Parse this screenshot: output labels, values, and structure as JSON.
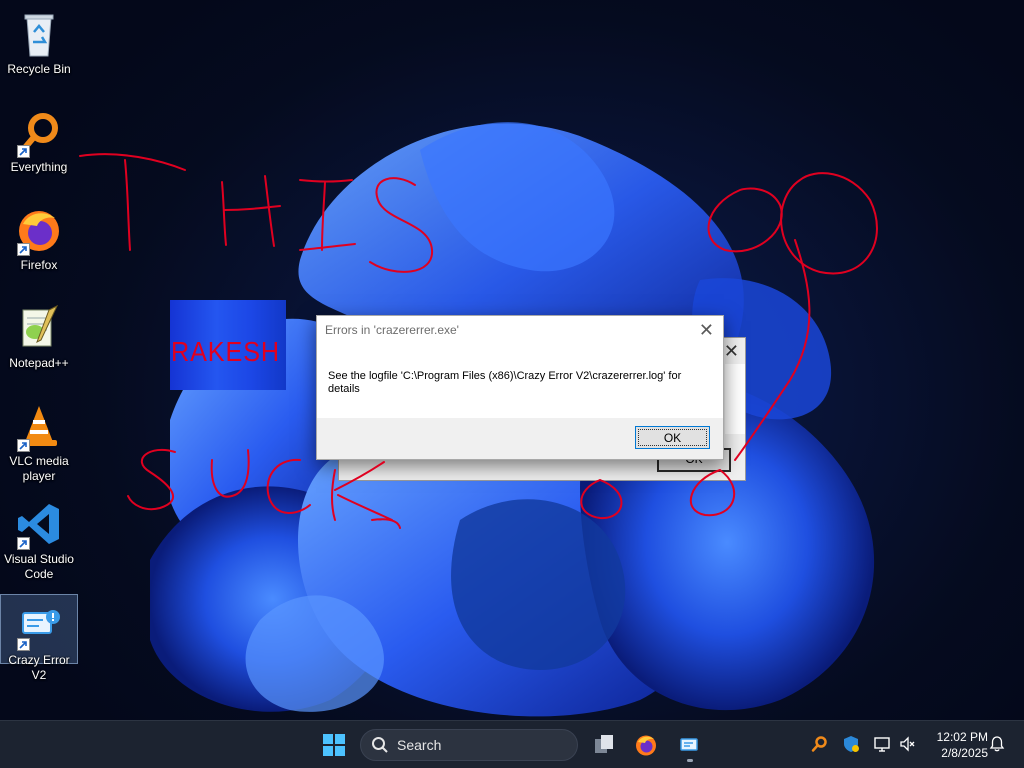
{
  "desktop_icons": [
    {
      "label": "Recycle Bin",
      "icon": "recycle-bin-icon",
      "shortcut": false
    },
    {
      "label": "Everything",
      "icon": "everything-icon",
      "shortcut": true
    },
    {
      "label": "Firefox",
      "icon": "firefox-icon",
      "shortcut": true
    },
    {
      "label": "Notepad++",
      "icon": "notepadpp-icon",
      "shortcut": false
    },
    {
      "label": "VLC media player",
      "icon": "vlc-icon",
      "shortcut": true
    },
    {
      "label": "Visual Studio Code",
      "icon": "vscode-icon",
      "shortcut": true
    },
    {
      "label": "Crazy Error V2",
      "icon": "crazy-error-icon",
      "shortcut": true,
      "selected": true
    }
  ],
  "overlay_image_text": "RAKESH",
  "back_dialog": {
    "ok_label": "OK"
  },
  "error_dialog": {
    "title": "Errors in 'crazererrer.exe'",
    "message": "See the logfile 'C:\\Program Files (x86)\\Crazy Error V2\\crazererrer.log' for details",
    "ok_label": "OK"
  },
  "taskbar": {
    "search_placeholder": "Search",
    "pinned": [
      "start-icon",
      "task-view-icon",
      "firefox-icon",
      "crazy-error-icon"
    ],
    "tray": [
      "everything-tray-icon",
      "security-icon",
      "network-icon",
      "volume-icon",
      "notification-bell-icon"
    ],
    "time": "12:02 PM",
    "date": "2/8/2025"
  },
  "colors": {
    "accent": "#0078d4",
    "scribble": "#e00020",
    "taskbar": "#1c2330"
  }
}
